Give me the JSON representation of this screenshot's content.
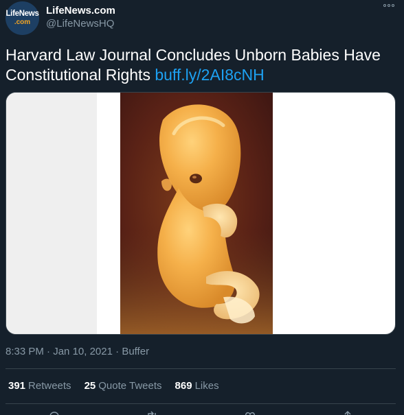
{
  "author": {
    "avatar_line1": "LifeNews",
    "avatar_line2": ".com",
    "display_name": "LifeNews.com",
    "handle": "@LifeNewsHQ"
  },
  "tweet": {
    "text": "Harvard Law Journal Concludes Unborn Babies Have Constitutional Rights",
    "link": "buff.ly/2AI8cNH"
  },
  "media": {
    "description": "photo-embryo"
  },
  "meta": {
    "time": "8:33 PM",
    "separator1": " · ",
    "date": "Jan 10, 2021",
    "separator2": " · ",
    "source": "Buffer"
  },
  "stats": [
    {
      "count": "391",
      "label": "Retweets"
    },
    {
      "count": "25",
      "label": "Quote Tweets"
    },
    {
      "count": "869",
      "label": "Likes"
    }
  ],
  "actions": [
    "reply-icon",
    "retweet-icon",
    "like-icon",
    "share-icon"
  ],
  "colors": {
    "background": "#15202b",
    "link": "#1da1f2",
    "secondary_text": "#8899a6",
    "divider": "#38444d"
  }
}
